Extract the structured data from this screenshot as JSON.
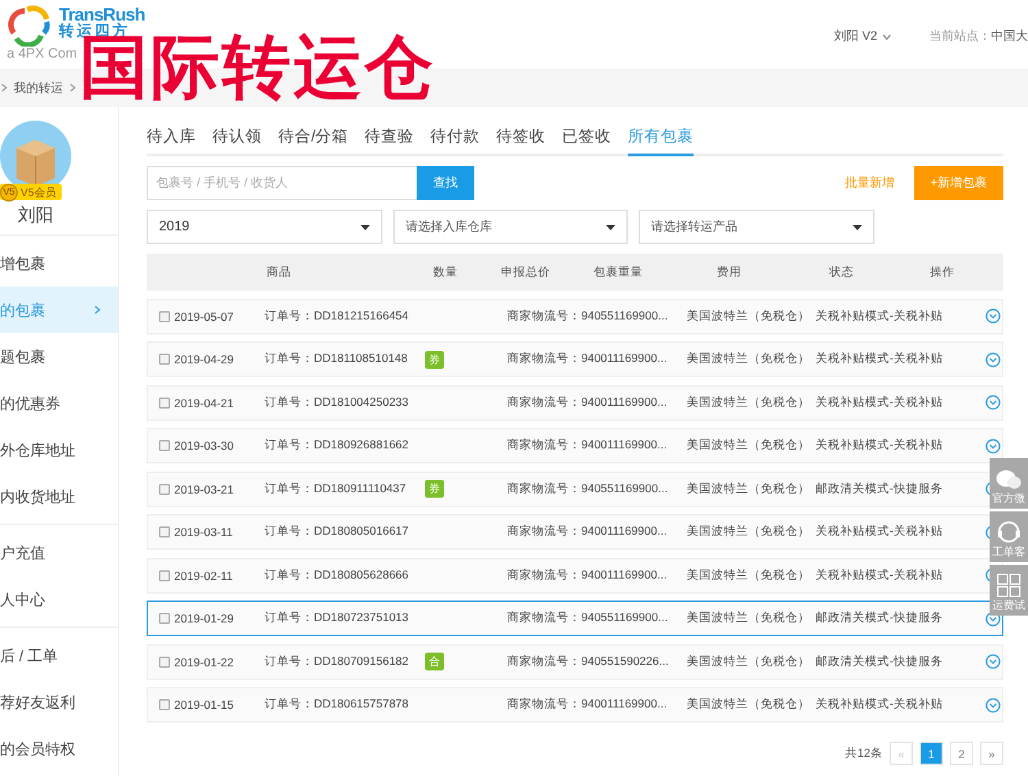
{
  "logo": {
    "brand": "TransRush",
    "brand_cn": "转运四方",
    "tagline": "a 4PX Com"
  },
  "overlay_title": "国际转运仓",
  "user_menu": {
    "label": "刘阳 V2"
  },
  "site": {
    "label": "当前站点：",
    "value": "中国大"
  },
  "breadcrumb": [
    "我的转运"
  ],
  "profile": {
    "level_icon": "V5",
    "level_label": "V5会员",
    "name": "刘阳"
  },
  "sidebar": {
    "groups": [
      [
        {
          "label": "增包裹",
          "selected": false
        },
        {
          "label": "的包裹",
          "selected": true
        },
        {
          "label": "题包裹",
          "selected": false
        },
        {
          "label": "的优惠券",
          "selected": false
        },
        {
          "label": "外仓库地址",
          "selected": false
        },
        {
          "label": "内收货地址",
          "selected": false
        }
      ],
      [
        {
          "label": "户充值",
          "selected": false
        },
        {
          "label": "人中心",
          "selected": false
        }
      ],
      [
        {
          "label": "后 / 工单",
          "selected": false
        },
        {
          "label": "荐好友返利",
          "selected": false
        },
        {
          "label": "的会员特权",
          "selected": false
        }
      ]
    ]
  },
  "tabs": [
    {
      "label": "待入库",
      "selected": false
    },
    {
      "label": "待认领",
      "selected": false
    },
    {
      "label": "待合/分箱",
      "selected": false
    },
    {
      "label": "待查验",
      "selected": false
    },
    {
      "label": "待付款",
      "selected": false
    },
    {
      "label": "待签收",
      "selected": false
    },
    {
      "label": "已签收",
      "selected": false
    },
    {
      "label": "所有包裹",
      "selected": true
    }
  ],
  "search": {
    "placeholder": "包裹号 / 手机号 / 收货人",
    "button": "查找"
  },
  "batch_add": "批量新增",
  "add_button": "+新增包裹",
  "filters": [
    {
      "value": "2019"
    },
    {
      "placeholder": "请选择入库仓库"
    },
    {
      "placeholder": "请选择转运产品"
    }
  ],
  "table": {
    "columns": [
      "商品",
      "数量",
      "申报总价",
      "包裹重量",
      "费用",
      "状态",
      "操作"
    ],
    "rows": [
      {
        "date": "2019-05-07",
        "order": "订单号：DD181215166454",
        "tracking": "商家物流号：940551169900...",
        "fee": "美国波特兰（免税仓）",
        "status": "关税补贴模式-关税补贴",
        "checked": false,
        "selected": false
      },
      {
        "date": "2019-04-29",
        "order": "订单号：DD181108510148",
        "badge": "券",
        "tracking": "商家物流号：940011169900...",
        "fee": "美国波特兰（免税仓）",
        "status": "关税补贴模式-关税补贴",
        "checked": false,
        "selected": false
      },
      {
        "date": "2019-04-21",
        "order": "订单号：DD181004250233",
        "tracking": "商家物流号：940011169900...",
        "fee": "美国波特兰（免税仓）",
        "status": "关税补贴模式-关税补贴",
        "checked": false,
        "selected": false
      },
      {
        "date": "2019-03-30",
        "order": "订单号：DD180926881662",
        "tracking": "商家物流号：940011169900...",
        "fee": "美国波特兰（免税仓）",
        "status": "关税补贴模式-关税补贴",
        "checked": false,
        "selected": false
      },
      {
        "date": "2019-03-21",
        "order": "订单号：DD180911110437",
        "badge": "券",
        "tracking": "商家物流号：940551169900...",
        "fee": "美国波特兰（免税仓）",
        "status": "邮政清关模式-快捷服务",
        "checked": false,
        "selected": false
      },
      {
        "date": "2019-03-11",
        "order": "订单号：DD180805016617",
        "tracking": "商家物流号：940011169900...",
        "fee": "美国波特兰（免税仓）",
        "status": "关税补贴模式-关税补贴",
        "checked": false,
        "selected": false
      },
      {
        "date": "2019-02-11",
        "order": "订单号：DD180805628666",
        "tracking": "商家物流号：940011169900...",
        "fee": "美国波特兰（免税仓）",
        "status": "关税补贴模式-关税补贴",
        "checked": false,
        "selected": false
      },
      {
        "date": "2019-01-29",
        "order": "订单号：DD180723751013",
        "tracking": "商家物流号：940551169900...",
        "fee": "美国波特兰（免税仓）",
        "status": "邮政清关模式-快捷服务",
        "checked": false,
        "selected": true
      },
      {
        "date": "2019-01-22",
        "order": "订单号：DD180709156182",
        "badge": "合",
        "tracking": "商家物流号：940551590226...",
        "fee": "美国波特兰（免税仓）",
        "status": "邮政清关模式-快捷服务",
        "checked": false,
        "selected": false
      },
      {
        "date": "2019-01-15",
        "order": "订单号：DD180615757878",
        "tracking": "商家物流号：940011169900...",
        "fee": "美国波特兰（免税仓）",
        "status": "关税补贴模式-关税补贴",
        "checked": false,
        "selected": false
      }
    ]
  },
  "pagination": {
    "total": "共12条",
    "prev": {
      "label": "«",
      "disabled": true
    },
    "pages": [
      {
        "label": "1",
        "selected": true
      },
      {
        "label": "2",
        "selected": false
      }
    ],
    "next": {
      "label": "»",
      "disabled": false
    }
  },
  "float_panel": [
    {
      "kind": "chat",
      "label": "官方微"
    },
    {
      "kind": "support",
      "label": "工单客"
    },
    {
      "kind": "calculator",
      "label": "运费试"
    }
  ]
}
